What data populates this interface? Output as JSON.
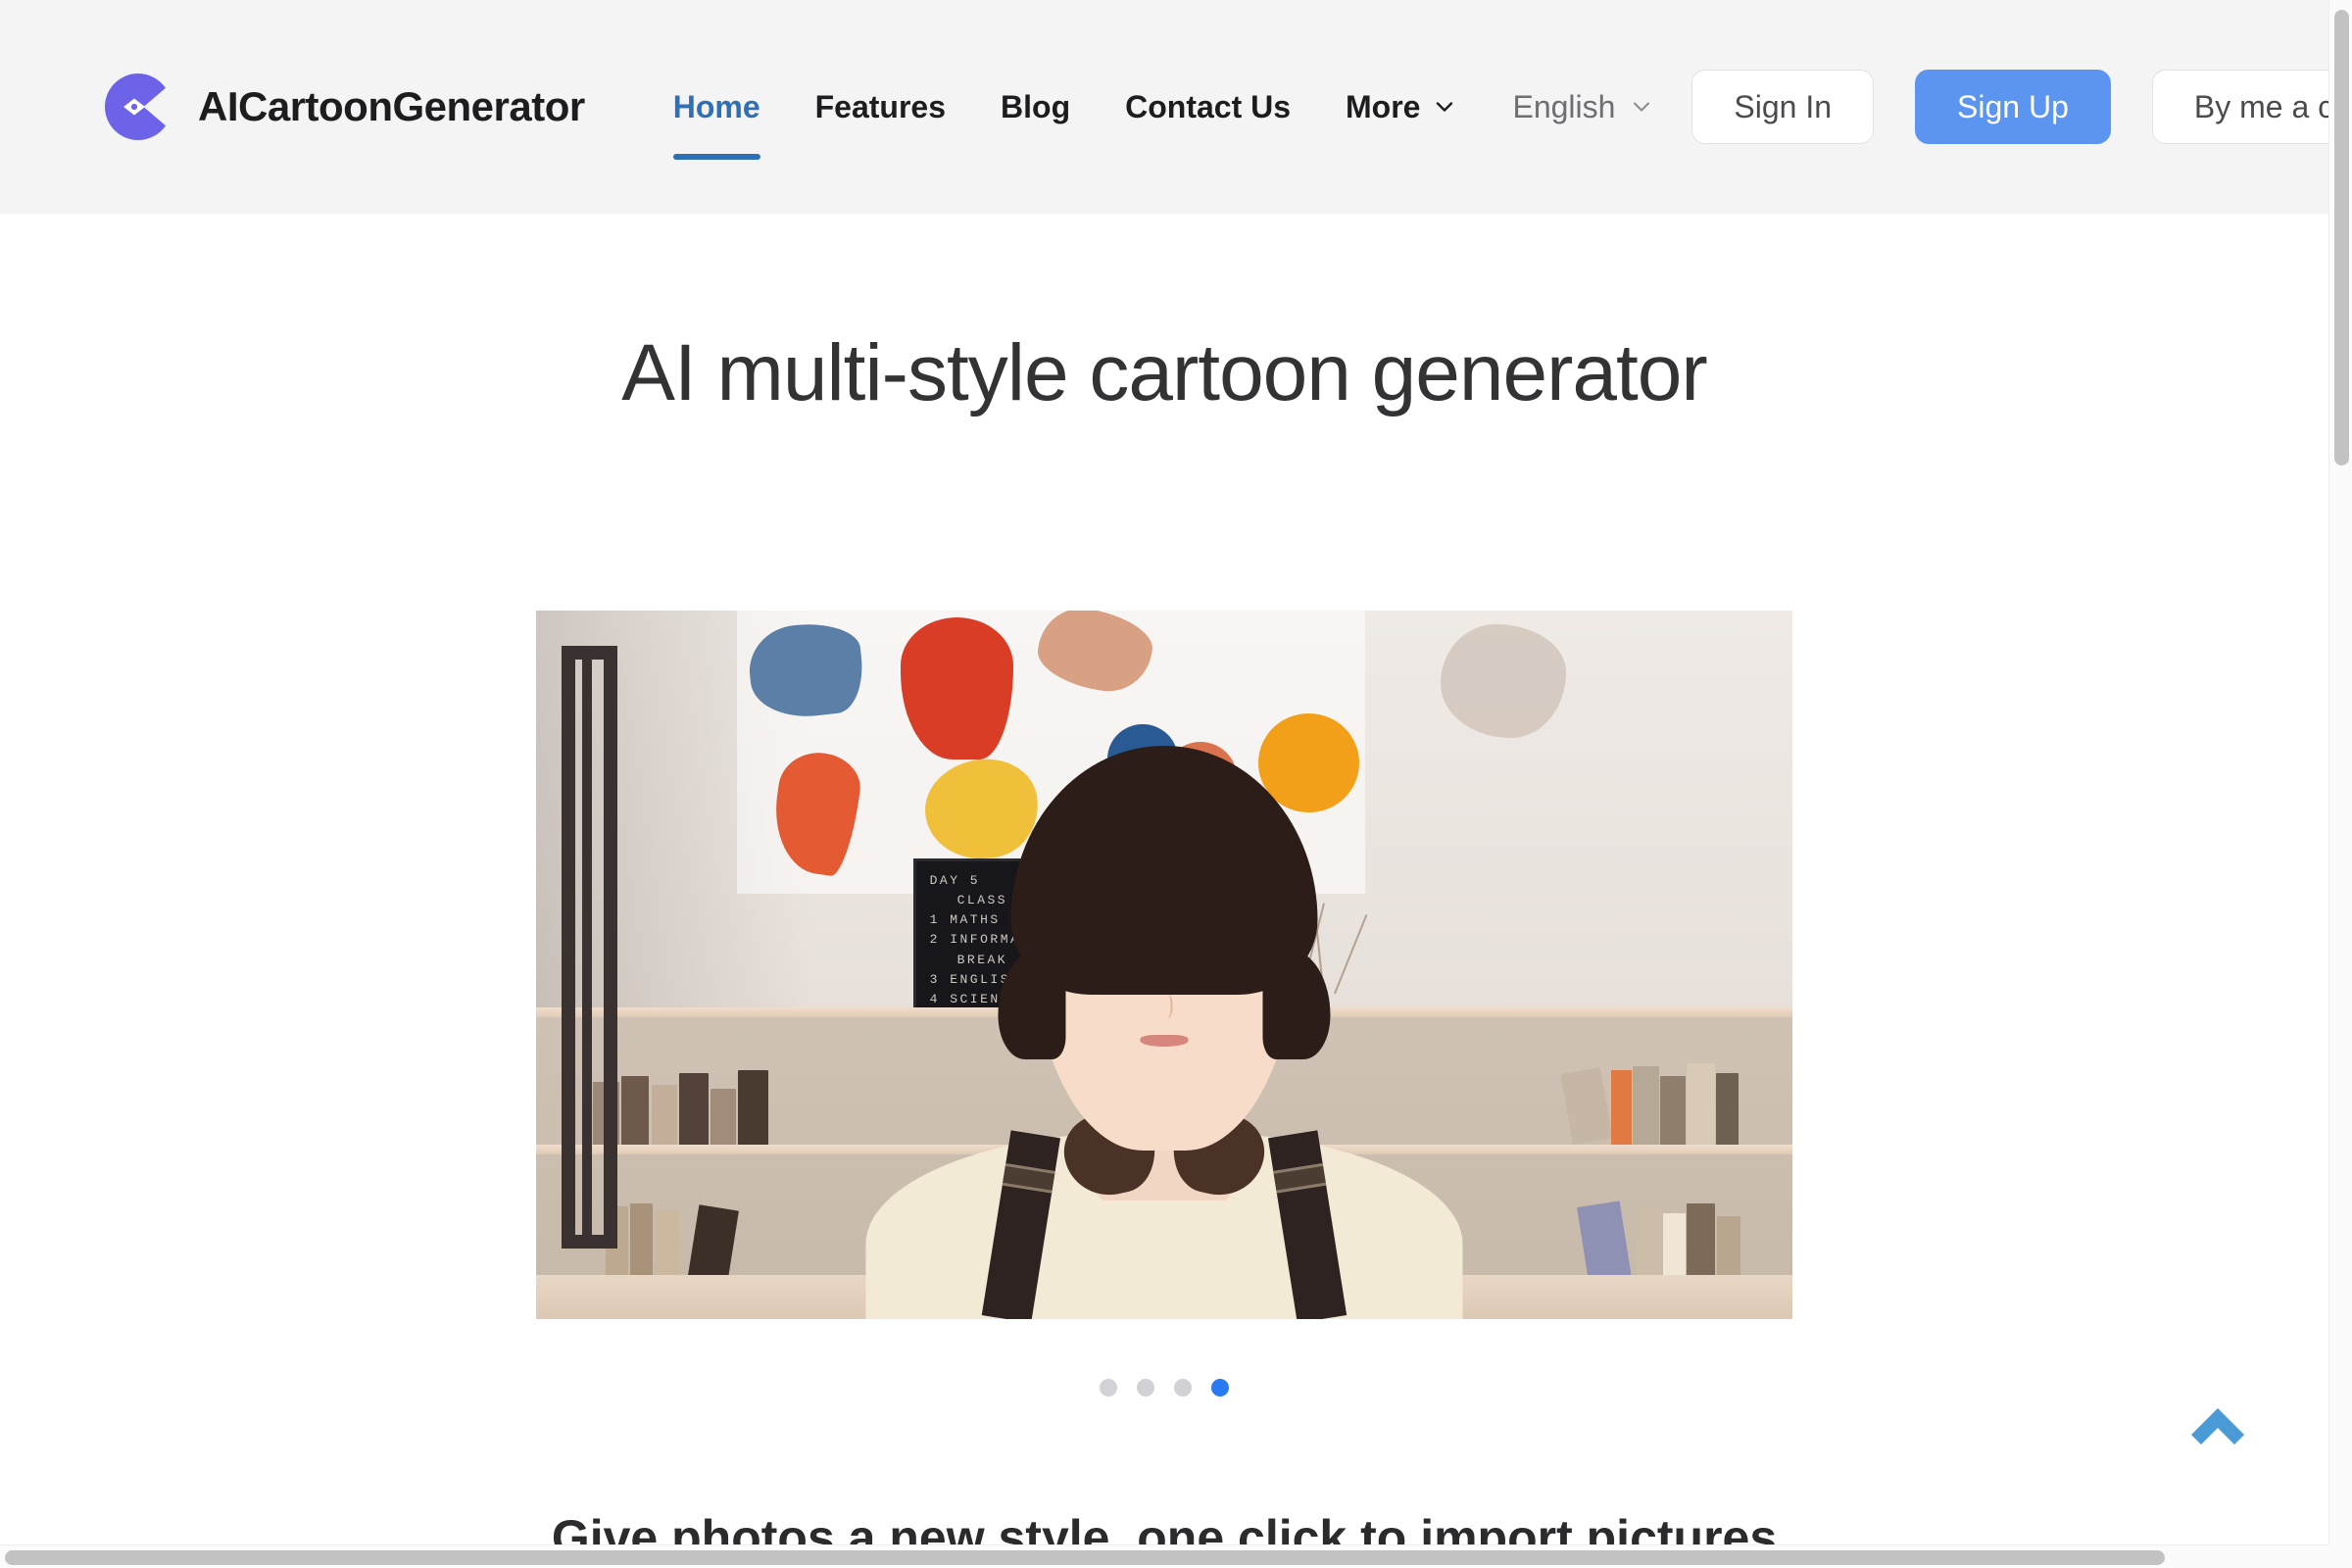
{
  "header": {
    "logo_icon": "cartoon-pen-logo-icon",
    "brand_name": "AICartoonGenerator",
    "nav": [
      {
        "label": "Home",
        "active": true
      },
      {
        "label": "Features",
        "active": false
      },
      {
        "label": "Blog",
        "active": false
      },
      {
        "label": "Contact Us",
        "active": false
      },
      {
        "label": "More",
        "active": false,
        "caret": "chevron-down-icon"
      }
    ],
    "language": {
      "value": "English",
      "caret": "chevron-down-icon"
    },
    "actions": {
      "sign_in": "Sign In",
      "sign_up": "Sign Up",
      "coffee": "By me a coffee"
    }
  },
  "hero": {
    "title": "AI multi-style cartoon generator",
    "media": {
      "alt": "Cartoon-style portrait of a student in a classroom",
      "scene": {
        "letterboard": {
          "line1": "DAY 5",
          "line2": "CLASS WORK",
          "line3": "1 MATHS",
          "line4": "2 INFORMATICS",
          "line5": "BREAK",
          "line6": "3 ENGLISH",
          "line7": "4 SCIENCE"
        },
        "wall_poster": "world-map-poster",
        "planets": [
          "blue-planet",
          "salmon-planet",
          "orange-planet"
        ],
        "subject": "student-portrait"
      }
    },
    "carousel": {
      "dots": [
        {
          "active": false
        },
        {
          "active": false
        },
        {
          "active": false
        },
        {
          "active": true
        }
      ]
    }
  },
  "section_teaser": {
    "text": "Give photos a new style, one click to import pictures"
  },
  "scroll_top": {
    "icon": "chevron-up-icon"
  },
  "colors": {
    "accent_blue": "#5b95ef",
    "link_blue": "#2f6fb5",
    "dot_active": "#2979f2",
    "logo_purple": "#6c63e8",
    "header_bg": "#f4f4f5",
    "scroll_top": "#4a9ad6"
  }
}
